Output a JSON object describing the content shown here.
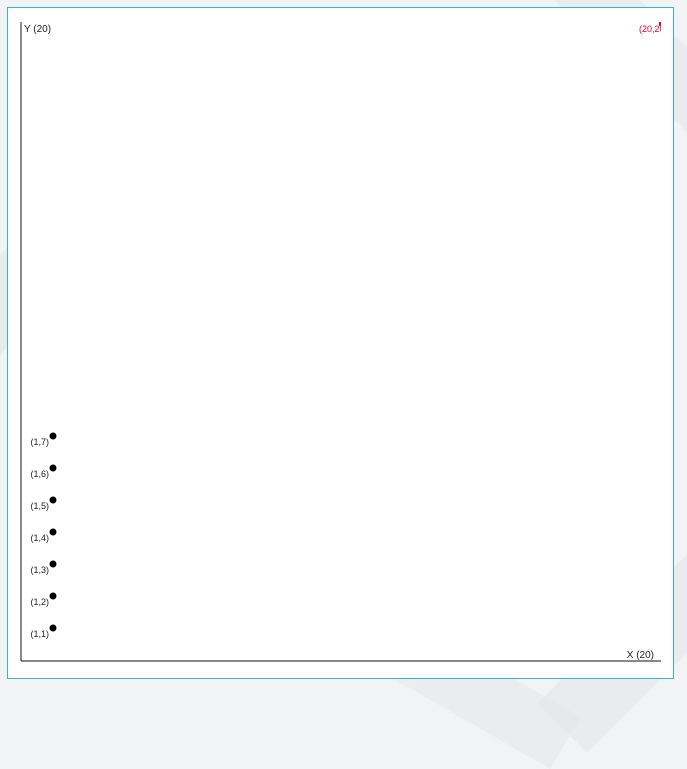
{
  "chart_data": {
    "type": "scatter",
    "title": "",
    "xlabel": "X (20)",
    "ylabel": "Y (20)",
    "xlim": [
      0,
      20
    ],
    "ylim": [
      0,
      20
    ],
    "grid": false,
    "points": [
      {
        "x": 1,
        "y": 1,
        "label": "(1,1)"
      },
      {
        "x": 1,
        "y": 2,
        "label": "(1,2)"
      },
      {
        "x": 1,
        "y": 3,
        "label": "(1,3)"
      },
      {
        "x": 1,
        "y": 4,
        "label": "(1,4)"
      },
      {
        "x": 1,
        "y": 5,
        "label": "(1,5)"
      },
      {
        "x": 1,
        "y": 6,
        "label": "(1,6)"
      },
      {
        "x": 1,
        "y": 7,
        "label": "(1,7)"
      }
    ],
    "highlight": {
      "x": 20,
      "y": 20,
      "label": "(20,20)",
      "color": "#e60026"
    },
    "point_color": "#000000",
    "frame_color": "#3ab3c9"
  }
}
